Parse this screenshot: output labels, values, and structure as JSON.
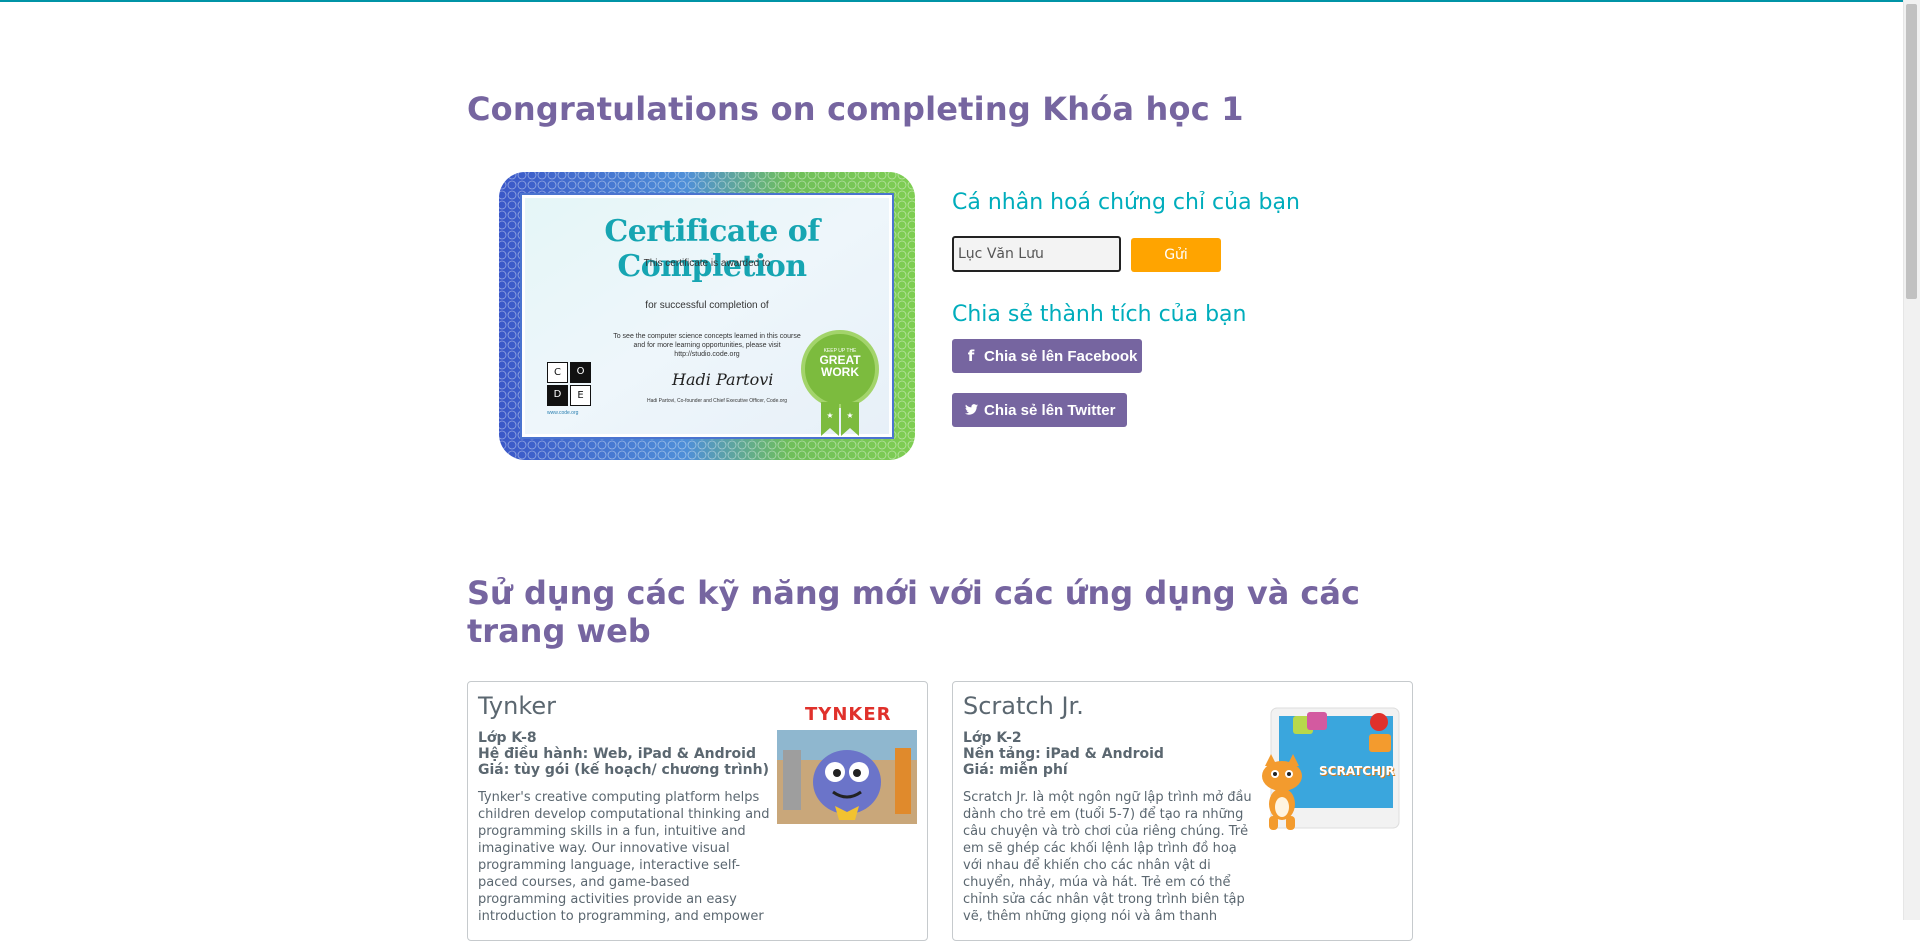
{
  "page": {
    "title": "Congratulations on completing Khóa học 1"
  },
  "certificate": {
    "heading": "Certificate of Completion",
    "awarded_to": "This certificate is awarded to",
    "for_completion": "for successful completion of",
    "note_line1": "To see the computer science concepts learned in this course",
    "note_line2": "and for more learning opportunities, please visit",
    "note_line3": "http://studio.code.org",
    "signer": "Hadi Partovi, Co-founder and Chief Executive Officer, Code.org",
    "signature": "Hadi Partovi",
    "site": "www.code.org",
    "badge_text_1": "GREAT",
    "badge_text_2": "WORK",
    "badge_top": "KEEP UP THE",
    "logo_letters": [
      "C",
      "O",
      "D",
      "E"
    ]
  },
  "personalize": {
    "heading": "Cá nhân hoá chứng chỉ của bạn",
    "name_value": "Lục Văn Lưu",
    "send_label": "Gửi"
  },
  "share": {
    "heading": "Chia sẻ thành tích của bạn",
    "facebook_label": "Chia sẻ lên Facebook",
    "twitter_label": "Chia sẻ lên Twitter"
  },
  "apps": {
    "heading": "Sử dụng các kỹ năng mới với các ứng dụng và các trang web",
    "cards": [
      {
        "name": "Tynker",
        "grade": "Lớp K-8",
        "platform": "Hệ điều hành: Web, iPad & Android",
        "price": "Giá: tùy gói (kế hoạch/ chương trình)",
        "description": "Tynker's creative computing platform helps children develop computational thinking and programming skills in a fun, intuitive and imaginative way. Our innovative visual programming language, interactive self-paced courses, and game-based programming activities provide an easy introduction to programming, and empower",
        "logo": "TYNKER"
      },
      {
        "name": "Scratch Jr.",
        "grade": "Lớp K-2",
        "platform": "Nền tảng: iPad & Android",
        "price": "Giá: miễn phí",
        "description": "Scratch Jr. là một ngôn ngữ lập trình mở đầu dành cho trẻ em (tuổi 5-7) để tạo ra những câu chuyện và trò chơi của riêng chúng. Trẻ em sẽ ghép các khối lệnh lập trình đồ hoạ với nhau để khiến cho các nhân vật di chuyển, nhảy, múa và hát. Trẻ em có thể chỉnh sửa các nhân vật trong trình biên tập vẽ, thêm những giọng nói và âm thanh",
        "logo": "SCRATCHJR"
      }
    ]
  },
  "colors": {
    "purple": "#7665a0",
    "teal": "#00adbc",
    "orange": "#ffa400",
    "text": "#5b6770"
  }
}
